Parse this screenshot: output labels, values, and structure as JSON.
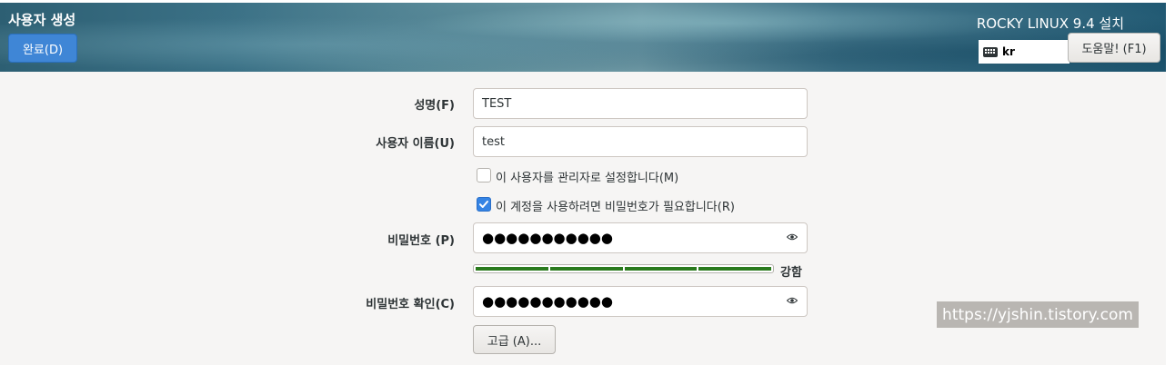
{
  "header": {
    "title": "사용자 생성",
    "done_label": "완료(D)",
    "install_title": "ROCKY LINUX 9.4 설치",
    "keyboard_layout": "kr",
    "help_label": "도움말! (F1)",
    "accent_color": "#3f86d6"
  },
  "form": {
    "fullname": {
      "label": "성명(F)",
      "value": "TEST"
    },
    "username": {
      "label": "사용자 이름(U)",
      "value": "test"
    },
    "admin_checkbox": {
      "label": "이 사용자를 관리자로 설정합니다(M)",
      "checked": false
    },
    "require_password_checkbox": {
      "label": "이 계정을 사용하려면 비밀번호가 필요합니다(R)",
      "checked": true
    },
    "password": {
      "label": "비밀번호 (P)",
      "value": "●●●●●●●●●●●"
    },
    "strength": {
      "label": "강함",
      "level": 1.0,
      "color": "#2a7a1d"
    },
    "confirm": {
      "label": "비밀번호 확인(C)",
      "value": "●●●●●●●●●●●"
    },
    "advanced_label": "고급 (A)..."
  },
  "watermark": "https://yjshin.tistory.com"
}
